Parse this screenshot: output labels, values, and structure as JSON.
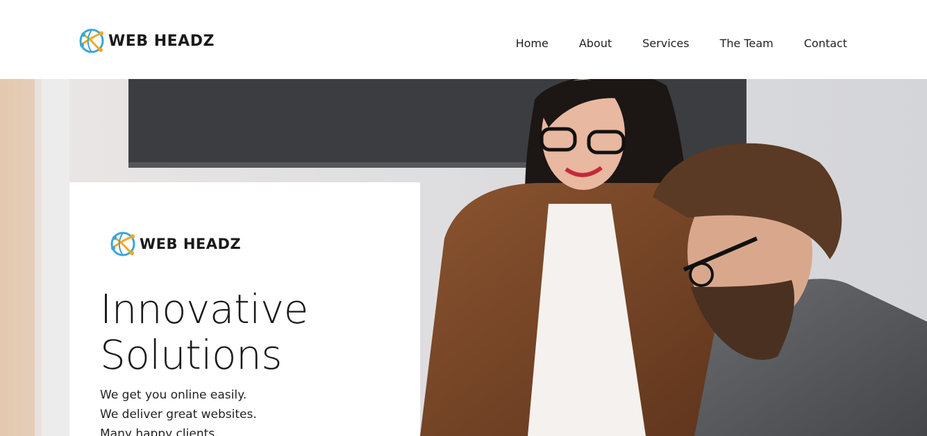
{
  "header": {
    "brand": "WEB HEADZ",
    "logo_icon": "globe-network-icon",
    "nav": [
      {
        "label": "Home"
      },
      {
        "label": "About"
      },
      {
        "label": "Services"
      },
      {
        "label": "The Team"
      },
      {
        "label": "Contact"
      }
    ]
  },
  "hero": {
    "image": "photo of two business colleagues smiling at a desk",
    "card": {
      "brand": "WEB HEADZ",
      "headline_line1": "Innovative",
      "headline_line2": "Solutions",
      "tagline": [
        "We get you online easily.",
        "We deliver great websites.",
        "Many happy clients."
      ]
    }
  },
  "colors": {
    "logo_orange": "#f5a623",
    "logo_blue": "#3aa6d8",
    "text_dark": "#1a1a1a",
    "header_bg": "#ffffff"
  }
}
